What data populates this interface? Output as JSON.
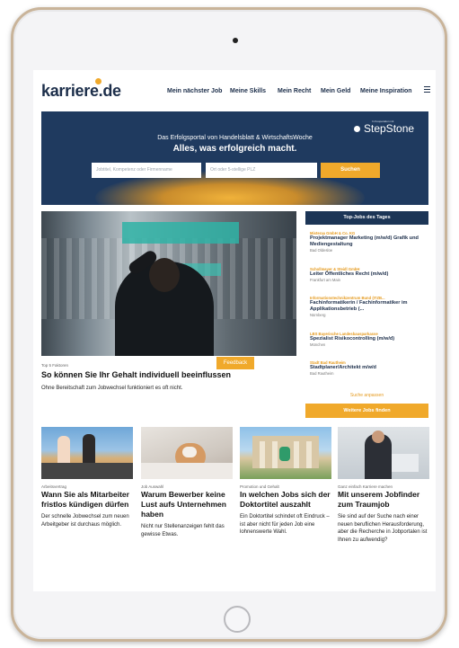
{
  "site": {
    "logo": "karriere.de",
    "nav": [
      "Mein nächster Job",
      "Meine Skills",
      "Mein Recht",
      "Mein Geld",
      "Meine Inspiration"
    ]
  },
  "hero": {
    "subtitle": "Das Erfolgsportal von Handelsblatt & WirtschaftsWoche",
    "title": "Alles, was erfolgreich macht.",
    "partner_small": "In Kooperation mit",
    "partner": "StepStone",
    "search_placeholder": "Jobtitel, Kompetenz oder Firmenname",
    "location_placeholder": "Ort oder 5-stellige PLZ",
    "search_button": "Suchen"
  },
  "featured": {
    "kicker": "Top 5 Faktoren",
    "title": "So können Sie Ihr Gehalt individuell beeinflussen",
    "text": "Ohne Bereitschaft zum Jobwechsel funktioniert es oft nicht.",
    "feedback": "Feedback"
  },
  "sidebar": {
    "heading": "Top-Jobs des Tages",
    "jobs": [
      {
        "company": "Misteraa GmbH & Co. KG",
        "title": "Projektmanager Marketing (m/w/d) Grafik und Mediengestaltung",
        "location": "Bad Oldesloe"
      },
      {
        "company": "Schollmeyer & Steidl GmbH",
        "title": "Leiter Öffentliches Recht (m/w/d)",
        "location": "Frankfurt am Main"
      },
      {
        "company": "Informationstechnikzentrum Bund (ITZB...",
        "title": "Fachinformatikerin / Fachinformatiker im Applikationsbetrieb (...",
        "location": "Nürnberg"
      },
      {
        "company": "LBS Bayerische Landesbausparkasse",
        "title": "Spezialist Risikocontrolling (m/w/d)",
        "location": "München"
      },
      {
        "company": "Stadt Bad Rautheim",
        "title": "Stadtplaner/Architekt m/w/d",
        "location": "Bad Rautheim"
      }
    ],
    "more_link": "Suche anpassen",
    "button": "Weitere Jobs finden"
  },
  "articles": [
    {
      "kicker": "Arbeitsvertrag",
      "title": "Wann Sie als Mitarbeiter fristlos kündigen dürfen",
      "text": "Der schnelle Jobwechsel zum neuen Arbeitgeber ist durchaus möglich."
    },
    {
      "kicker": "Job Auswahl",
      "title": "Warum Bewerber keine Lust aufs Unternehmen haben",
      "text": "Nicht nur Stellenanzeigen fehlt das gewisse Etwas."
    },
    {
      "kicker": "Promotion und Gehalt",
      "title": "In welchen Jobs sich der Doktortitel auszahlt",
      "text": "Ein Doktortitel schindet oft Eindruck – ist aber nicht für jeden Job eine lohnenswerte Wahl."
    },
    {
      "kicker": "Ganz einfach Karriere machen",
      "title": "Mit unserem Jobfinder zum Traumjob",
      "text": "Sie sind auf der Suche nach einer neuen beruflichen Herausforderung, aber die Recherche in Jobportalen ist Ihnen zu aufwendig?"
    }
  ],
  "colors": {
    "navy": "#1c3556",
    "accent": "#f0a92b",
    "bezel": "#c9b49a"
  }
}
